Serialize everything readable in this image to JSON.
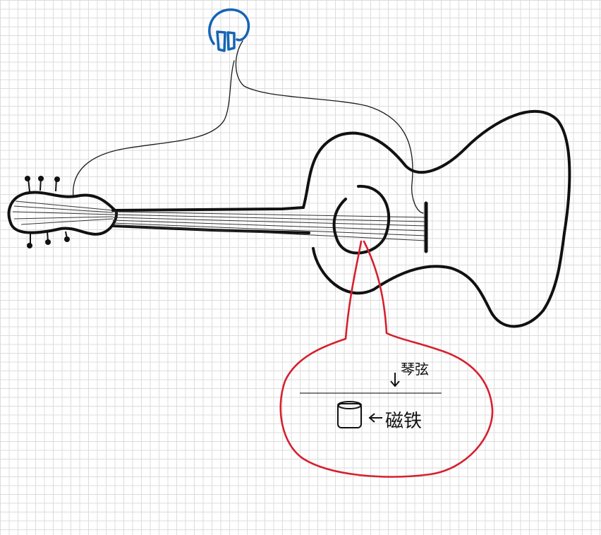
{
  "diagram": {
    "labels": {
      "string_label": "琴弦",
      "magnet_label": "磁铁"
    },
    "colors": {
      "guitar_ink": "#111111",
      "callout_ink": "#d6202e",
      "earphone_ink": "#1464b4",
      "grid_line": "#dcdcdc"
    },
    "parts": [
      "headstock",
      "tuning-pegs",
      "neck",
      "strings",
      "body",
      "sound-hole",
      "bridge",
      "cable",
      "earphone",
      "magnet-callout"
    ]
  }
}
